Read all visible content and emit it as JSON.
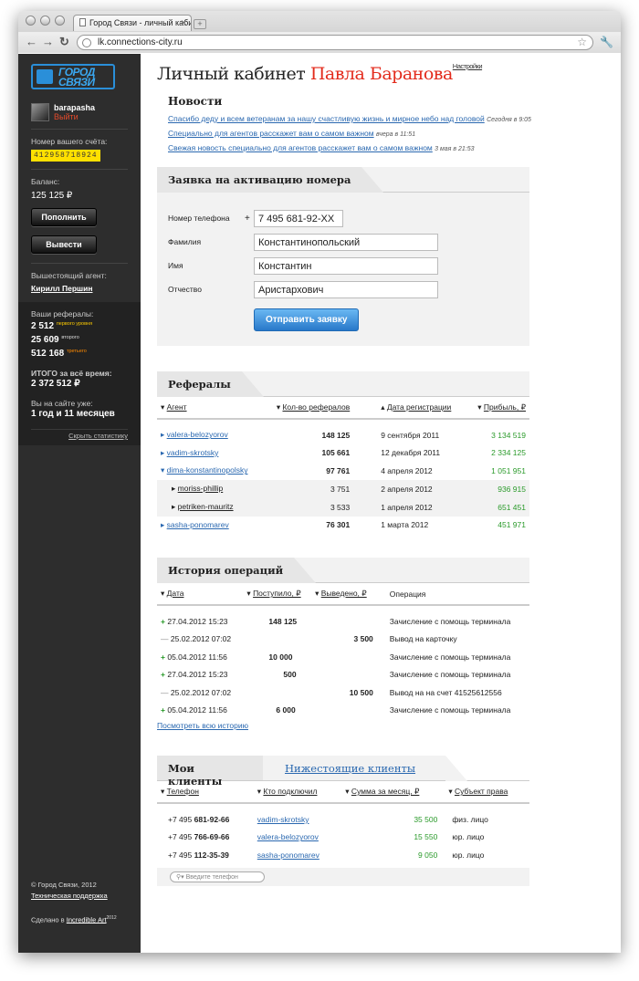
{
  "browser": {
    "tab_title": "Город Связи - личный кабин",
    "url": "lk.connections-city.ru"
  },
  "sidebar": {
    "logo_text": "ГОРОД СВЯЗИ",
    "username": "barapasha",
    "logout": "Выйти",
    "account_label": "Номер вашего счёта:",
    "account_number": "412958718924",
    "balance_label": "Баланс:",
    "balance": "125 125 ₽",
    "topup": "Пополнить",
    "withdraw": "Вывести",
    "agent_label": "Вышестоящий агент:",
    "agent": "Кирилл Першин",
    "refs_label": "Ваши рефералы:",
    "lvl1": "2 512",
    "lvl1_label": "первого уровня",
    "lvl2": "25 609",
    "lvl2_label": "второго",
    "lvl3": "512 168",
    "lvl3_label": "третьего",
    "total_label": "ИТОГО за всё время:",
    "total": "2 372 512 ₽",
    "site_label": "Вы на сайте уже:",
    "site_time": "1 год и 11 месяцев",
    "hide_stats": "Скрыть статистику",
    "copyright": "© Город Связи, 2012",
    "support": "Техническая поддержка",
    "made_in": "Сделано в",
    "made_link": "Incredible Art",
    "made_year": "2012"
  },
  "header": {
    "title": "Личный кабинет",
    "name": "Павла Баранова",
    "settings": "Настройки"
  },
  "news": {
    "title": "Новости",
    "items": [
      {
        "text": "Спасибо деду и всем ветеранам за нашу счастливую жизнь и мирное небо над головой",
        "date": "Сегодня в 9:05"
      },
      {
        "text": "Специально для агентов расскажет вам о самом важном",
        "date": "вчера в 11:51"
      },
      {
        "text": "Свежая новость специально для агентов расскажет вам о самом важном",
        "date": "3 мая в 21:53"
      }
    ]
  },
  "activation": {
    "title": "Заявка на активацию номера",
    "phone_label": "Номер телефона",
    "phone_prefix": "+",
    "phone": "7 495 681-92-XX",
    "surname_label": "Фамилия",
    "surname": "Константинопольский",
    "name_label": "Имя",
    "name": "Константин",
    "patronymic_label": "Отчество",
    "patronymic": "Аристархович",
    "submit": "Отправить заявку"
  },
  "referrals": {
    "title": "Рефералы",
    "headers": [
      "Агент",
      "Кол-во рефералов",
      "Дата регистрации",
      "Прибыль, ₽"
    ],
    "rows": [
      {
        "agent": "valera-belozyorov",
        "count": "148 125",
        "date": "9 сентября 2011",
        "profit": "3 134 519"
      },
      {
        "agent": "vadim-skrotsky",
        "count": "105 661",
        "date": "12 декабря 2011",
        "profit": "2 334 125"
      },
      {
        "agent": "dima-konstantinopolsky",
        "count": "97 761",
        "date": "4 апреля 2012",
        "profit": "1 051 951"
      },
      {
        "agent": "moriss-phillip",
        "count": "3 751",
        "date": "2 апреля 2012",
        "profit": "936 915"
      },
      {
        "agent": "petriken-mauritz",
        "count": "3 533",
        "date": "1 апреля 2012",
        "profit": "651 451"
      },
      {
        "agent": "sasha-ponomarev",
        "count": "76 301",
        "date": "1 марта 2012",
        "profit": "451 971"
      }
    ]
  },
  "history": {
    "title": "История операций",
    "headers": [
      "Дата",
      "Поступило, ₽",
      "Выведено, ₽",
      "Операция"
    ],
    "rows": [
      {
        "sign": "+",
        "date": "27.04.2012 15:23",
        "in": "148 125",
        "out": "",
        "op": "Зачисление с помощь терминала"
      },
      {
        "sign": "—",
        "date": "25.02.2012 07:02",
        "in": "",
        "out": "3 500",
        "op": "Вывод на карточку"
      },
      {
        "sign": "+",
        "date": "05.04.2012 11:56",
        "in": "10 000",
        "out": "",
        "op": "Зачисление с помощь терминала"
      },
      {
        "sign": "+",
        "date": "27.04.2012 15:23",
        "in": "500",
        "out": "",
        "op": "Зачисление с помощь терминала"
      },
      {
        "sign": "—",
        "date": "25.02.2012 07:02",
        "in": "",
        "out": "10 500",
        "op": "Вывод на на счет 41525612556"
      },
      {
        "sign": "+",
        "date": "05.04.2012 11:56",
        "in": "6 000",
        "out": "",
        "op": "Зачисление с помощь терминала"
      }
    ],
    "all_link": "Посмотреть всю историю"
  },
  "clients": {
    "tab_mine": "Мои клиенты",
    "tab_lower": "Нижестоящие клиенты",
    "headers": [
      "Телефон",
      "Кто подключил",
      "Сумма за месяц, ₽",
      "Субъект права"
    ],
    "rows": [
      {
        "code": "+7 495",
        "phone": "681-92-66",
        "who": "vadim-skrotsky",
        "sum": "35 500",
        "type": "физ. лицо"
      },
      {
        "code": "+7 495",
        "phone": "766-69-66",
        "who": "valera-belozyorov",
        "sum": "15 550",
        "type": "юр. лицо"
      },
      {
        "code": "+7 495",
        "phone": "112-35-39",
        "who": "sasha-ponomarev",
        "sum": "9 050",
        "type": "юр. лицо"
      }
    ],
    "search_placeholder": "Введите телефон"
  }
}
